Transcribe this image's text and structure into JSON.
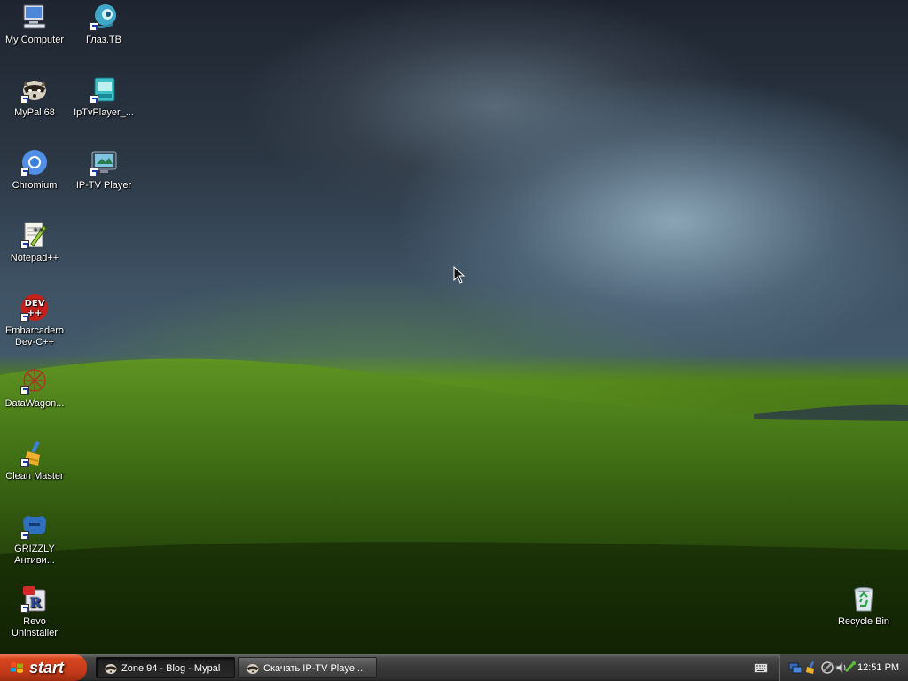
{
  "desktop": {
    "icons": [
      {
        "label": "My Computer",
        "icon": "my-computer-icon",
        "shortcut": false
      },
      {
        "label": "Глаз.ТВ",
        "icon": "glaz-tv-icon",
        "shortcut": true
      },
      {
        "label": "MyPal 68",
        "icon": "mypal-raccoon-icon",
        "shortcut": true
      },
      {
        "label": "IpTvPlayer_...",
        "icon": "iptvplayer-icon",
        "shortcut": true
      },
      {
        "label": "Chromium",
        "icon": "chromium-icon",
        "shortcut": true
      },
      {
        "label": "IP-TV Player",
        "icon": "ip-tv-player-icon",
        "shortcut": true
      },
      {
        "label": "Notepad++",
        "icon": "notepad-plus-plus-icon",
        "shortcut": true
      },
      {
        "label": "Embarcadero Dev-C++",
        "icon": "dev-cpp-icon",
        "shortcut": true,
        "badge_text": "DEV\n++"
      },
      {
        "label": "DataWagon...",
        "icon": "datawagon-icon",
        "shortcut": true
      },
      {
        "label": "Clean Master",
        "icon": "clean-master-icon",
        "shortcut": true
      },
      {
        "label": "GRIZZLY Антиви...",
        "icon": "grizzly-antivirus-icon",
        "shortcut": true
      },
      {
        "label": "Revo Uninstaller",
        "icon": "revo-uninstaller-icon",
        "shortcut": true
      },
      {
        "label": "Recycle Bin",
        "icon": "recycle-bin-icon",
        "shortcut": false
      }
    ]
  },
  "taskbar": {
    "start_label": "start",
    "tasks": [
      {
        "label": "Zone 94 - Blog - Mypal",
        "icon": "mypal-raccoon-icon",
        "active": true
      },
      {
        "label": "Скачать IP-TV Playe...",
        "icon": "mypal-raccoon-icon",
        "active": false
      }
    ],
    "tray": {
      "icons": [
        "network-icon",
        "clean-master-tray-icon",
        "satellite-icon",
        "volume-icon",
        "safely-remove-icon"
      ],
      "clock": "12:51 PM"
    }
  },
  "colors": {
    "start_button": "#c2391a",
    "taskbar": "#3a3a3a",
    "label_text": "#ffffff"
  }
}
